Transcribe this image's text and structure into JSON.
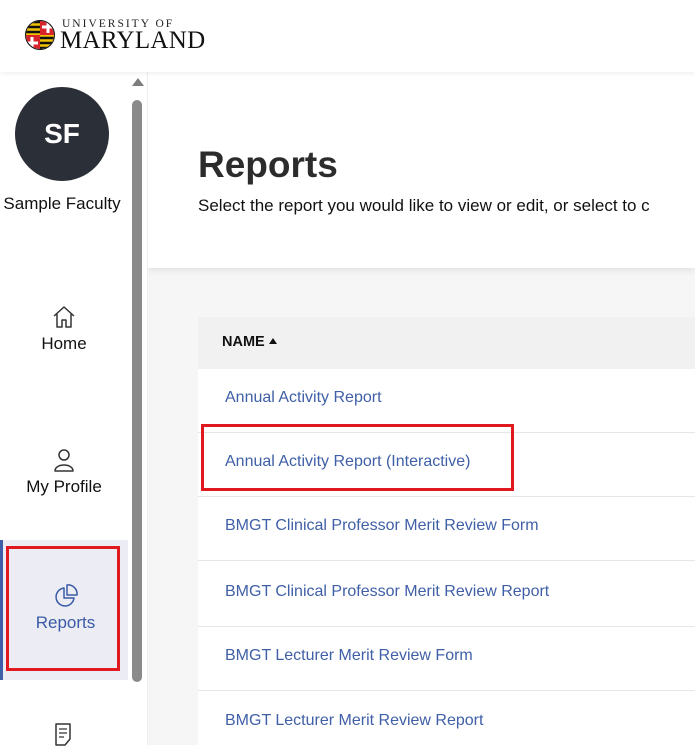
{
  "header": {
    "logo_top": "UNIVERSITY OF",
    "logo_main": "MARYLAND"
  },
  "user": {
    "initials": "SF",
    "name": "Sample Faculty"
  },
  "nav": {
    "home": "Home",
    "profile": "My Profile",
    "reports": "Reports"
  },
  "page": {
    "title": "Reports",
    "subtitle": "Select the report you would like to view or edit, or select to c"
  },
  "table": {
    "column_name": "NAME",
    "rows": [
      "Annual Activity Report",
      "Annual Activity Report (Interactive)",
      "BMGT Clinical Professor Merit Review Form",
      "BMGT Clinical Professor Merit Review Report",
      "BMGT Lecturer Merit Review Form",
      "BMGT Lecturer Merit Review Report"
    ]
  },
  "colors": {
    "accent": "#3f5fa7",
    "highlight": "#e0181f",
    "avatar_bg": "#2b2f38"
  }
}
